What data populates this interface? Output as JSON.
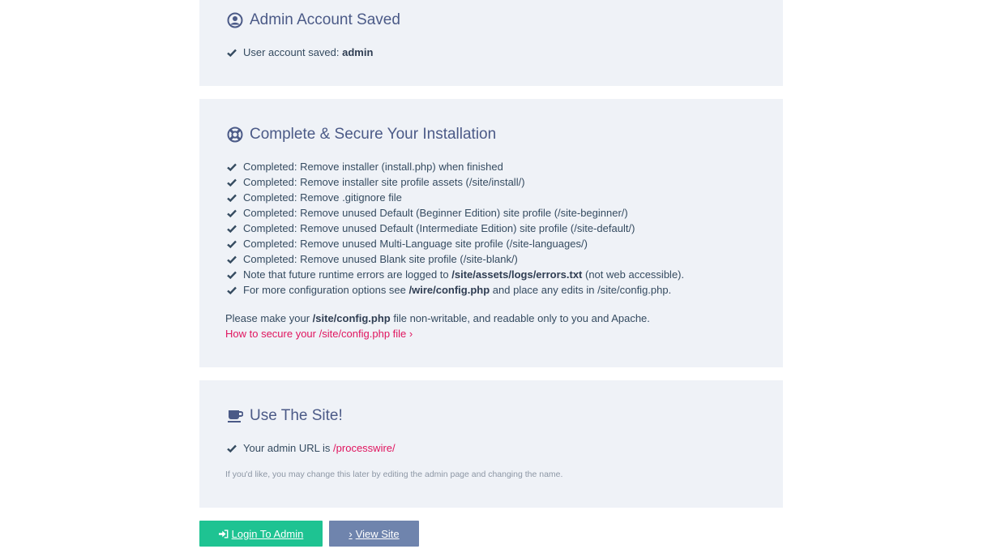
{
  "saved": {
    "title": "Admin Account Saved",
    "item_prefix": "User account saved: ",
    "item_bold": "admin"
  },
  "secure": {
    "title": "Complete & Secure Your Installation",
    "items": [
      "Completed: Remove installer (install.php) when finished",
      "Completed: Remove installer site profile assets (/site/install/)",
      "Completed: Remove .gitignore file",
      "Completed: Remove unused Default (Beginner Edition) site profile (/site-beginner/)",
      "Completed: Remove unused Default (Intermediate Edition) site profile (/site-default/)",
      "Completed: Remove unused Multi-Language site profile (/site-languages/)",
      "Completed: Remove unused Blank site profile (/site-blank/)"
    ],
    "note_errors": {
      "before": "Note that future runtime errors are logged to ",
      "bold": "/site/assets/logs/errors.txt",
      "after": " (not web accessible)."
    },
    "note_config": {
      "before": "For more configuration options see ",
      "bold": "/wire/config.php",
      "after": " and place any edits in /site/config.php."
    },
    "para": {
      "before": "Please make your ",
      "bold": "/site/config.php",
      "after": " file non-writable, and readable only to you and Apache."
    },
    "link_label": "How to secure your /site/config.php file",
    "link_arrow": "›"
  },
  "use": {
    "title": "Use The Site!",
    "admin_url_prefix": "Your admin URL is ",
    "admin_url": "/processwire/",
    "hint": "If you'd like, you may change this later by editing the admin page and changing the name."
  },
  "buttons": {
    "login_label": "Login To Admin",
    "view_arrow": "›",
    "view_label": "View Site"
  },
  "colors": {
    "panel_bg": "#eff2f7",
    "heading": "#4b5a87",
    "link": "#e0155f",
    "login_button": "#1ec392",
    "view_button": "#6f84ad"
  }
}
